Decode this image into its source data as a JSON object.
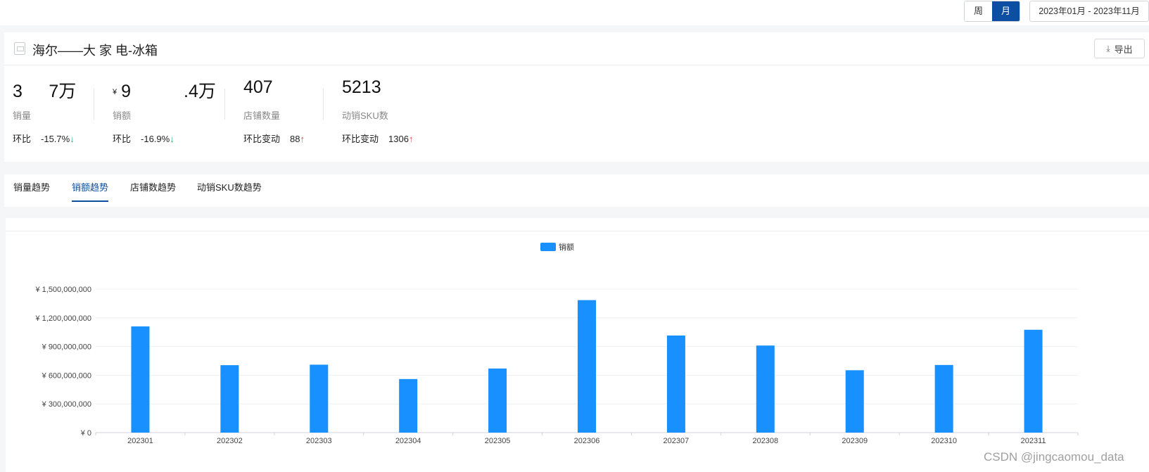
{
  "header": {
    "period_toggle": [
      {
        "label": "周",
        "active": false
      },
      {
        "label": "月",
        "active": true
      }
    ],
    "date_range": "2023年01月 - 2023年11月"
  },
  "summary": {
    "title": "海尔——大 家 电-冰箱",
    "export_label": "导出",
    "metrics": [
      {
        "value": "3   7万",
        "currency": "",
        "label": "销量",
        "delta_label": "环比",
        "delta_value": "-15.7%",
        "direction": "down",
        "arrow": "↓"
      },
      {
        "value": "9      .4万",
        "currency": "¥",
        "label": "销额",
        "delta_label": "环比",
        "delta_value": "-16.9%",
        "direction": "down",
        "arrow": "↓"
      },
      {
        "value": "407",
        "currency": "",
        "label": "店铺数量",
        "delta_label": "环比变动",
        "delta_value": "88",
        "direction": "up",
        "arrow": "↑"
      },
      {
        "value": "5213",
        "currency": "",
        "label": "动销SKU数",
        "delta_label": "环比变动",
        "delta_value": "1306",
        "direction": "up",
        "arrow": "↑"
      }
    ]
  },
  "tabs": [
    {
      "label": "销量趋势",
      "active": false
    },
    {
      "label": "销额趋势",
      "active": true
    },
    {
      "label": "店铺数趋势",
      "active": false
    },
    {
      "label": "动销SKU数趋势",
      "active": false
    }
  ],
  "chart_data": {
    "type": "bar",
    "categories": [
      "202301",
      "202302",
      "202303",
      "202304",
      "202305",
      "202306",
      "202307",
      "202308",
      "202309",
      "202310",
      "202311"
    ],
    "series": [
      {
        "name": "销额",
        "values": [
          1110000000,
          705000000,
          710000000,
          560000000,
          670000000,
          1385000000,
          1015000000,
          910000000,
          652000000,
          707000000,
          1075000000
        ]
      }
    ],
    "ylim": [
      0,
      1500000000
    ],
    "yticks": [
      0,
      300000000,
      600000000,
      900000000,
      1200000000,
      1500000000
    ],
    "ytick_labels": [
      "¥ 0",
      "¥ 300,000,000",
      "¥ 600,000,000",
      "¥ 900,000,000",
      "¥ 1,200,000,000",
      "¥ 1,500,000,000"
    ],
    "legend_position": "top-center",
    "grid": true,
    "color": "#1890ff"
  },
  "watermark": "CSDN @jingcaomou_data"
}
